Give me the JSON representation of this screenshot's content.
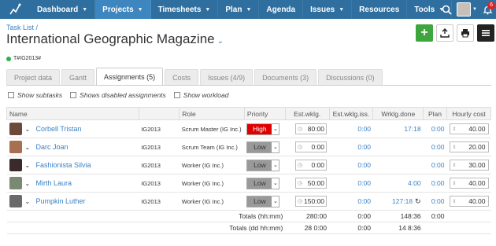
{
  "nav": {
    "items": [
      "Dashboard",
      "Projects",
      "Timesheets",
      "Plan",
      "Agenda",
      "Issues",
      "Resources",
      "Tools"
    ],
    "notification_count": "6"
  },
  "header": {
    "breadcrumb": "Task List /",
    "title": "International Geographic Magazine",
    "code": "T#IG2013#"
  },
  "tabs": [
    "Project data",
    "Gantt",
    "Assignments (5)",
    "Costs",
    "Issues (4/9)",
    "Documents (3)",
    "Discussions (0)"
  ],
  "options": [
    "Show subtasks",
    "Shows disabled assignments",
    "Show workload"
  ],
  "columns": [
    "Name",
    "Role",
    "Priority",
    "Est.wklg.",
    "Est.wklg.iss.",
    "Wrklg.done",
    "Plan",
    "Hourly cost"
  ],
  "rows": [
    {
      "name": "Corbell Tristan",
      "code": "IG2013",
      "role": "Scrum Master (IG Inc.)",
      "priority": "High",
      "est": "80:00",
      "est_iss": "0:00",
      "done": "17:18",
      "plan": "0:00",
      "cost": "40.00",
      "avatar": "#6b4a3a"
    },
    {
      "name": "Darc Joan",
      "code": "IG2013",
      "role": "Scrum Team (IG Inc.)",
      "priority": "Low",
      "est": "0:00",
      "est_iss": "0:00",
      "done": "",
      "plan": "0:00",
      "cost": "20.00",
      "avatar": "#a87050"
    },
    {
      "name": "Fashionista Silvia",
      "code": "IG2013",
      "role": "Worker (IG Inc.)",
      "priority": "Low",
      "est": "0:00",
      "est_iss": "0:00",
      "done": "",
      "plan": "0:00",
      "cost": "30.00",
      "avatar": "#3a2a2a"
    },
    {
      "name": "Mirth Laura",
      "code": "IG2013",
      "role": "Worker (IG Inc.)",
      "priority": "Low",
      "est": "50:00",
      "est_iss": "0:00",
      "done": "4:00",
      "plan": "0:00",
      "cost": "40.00",
      "avatar": "#7a8a70"
    },
    {
      "name": "Pumpkin Luther",
      "code": "IG2013",
      "role": "Worker (IG Inc.)",
      "priority": "Low",
      "est": "150:00",
      "est_iss": "0:00",
      "done": "127:18",
      "plan": "0:00",
      "cost": "40.00",
      "avatar": "#6a6a6a"
    }
  ],
  "totals": {
    "hhmm_label": "Totals (hh:mm)",
    "hhmm_est": "280:00",
    "hhmm_iss": "0:00",
    "hhmm_done": "148:36",
    "hhmm_plan": "0:00",
    "ddhh_label": "Totals (dd hh:mm)",
    "ddhh_est": "28 0:00",
    "ddhh_iss": "0:00",
    "ddhh_done": "14 8:36"
  },
  "colors": {
    "nav": "#2f6f9f",
    "active": "#3d86bf",
    "link": "#3b82c4",
    "high": "#e00000",
    "add": "#3fa63f"
  }
}
